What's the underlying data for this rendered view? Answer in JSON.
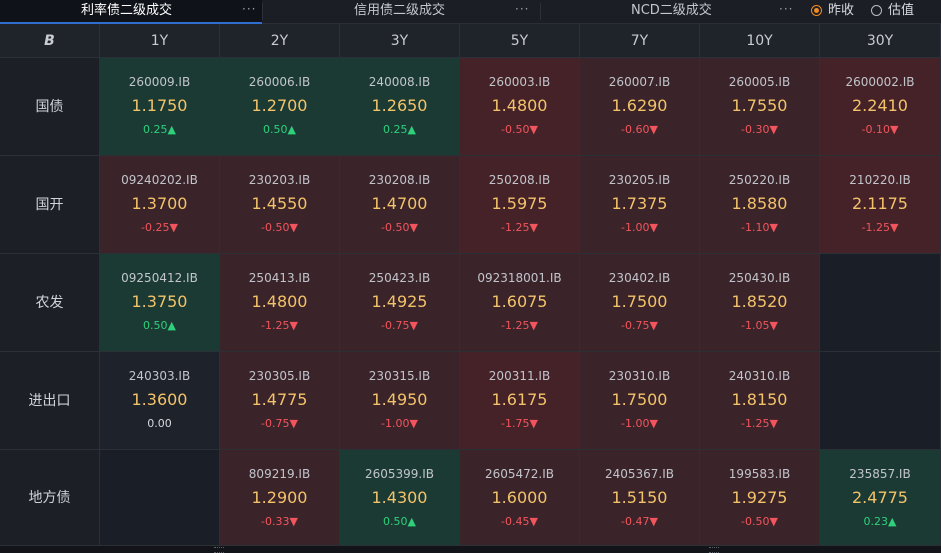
{
  "tabs": [
    {
      "label": "利率债二级成交",
      "active": true,
      "more": "···"
    },
    {
      "label": "信用债二级成交",
      "active": false,
      "more": "···"
    },
    {
      "label": "NCD二级成交",
      "active": false,
      "more": "···"
    }
  ],
  "radios": [
    {
      "label": "昨收",
      "checked": true
    },
    {
      "label": "估值",
      "checked": false
    }
  ],
  "corner_symbol": "B",
  "columns": [
    "1Y",
    "2Y",
    "3Y",
    "5Y",
    "7Y",
    "10Y",
    "30Y"
  ],
  "rows": [
    {
      "label": "国债",
      "cells": [
        {
          "code": "260009.IB",
          "price": "1.1750",
          "change": "0.25",
          "dir": "up"
        },
        {
          "code": "260006.IB",
          "price": "1.2700",
          "change": "0.50",
          "dir": "up"
        },
        {
          "code": "240008.IB",
          "price": "1.2650",
          "change": "0.25",
          "dir": "up"
        },
        {
          "code": "260003.IB",
          "price": "1.4800",
          "change": "-0.50",
          "dir": "down"
        },
        {
          "code": "260007.IB",
          "price": "1.6290",
          "change": "-0.60",
          "dir": "down"
        },
        {
          "code": "260005.IB",
          "price": "1.7550",
          "change": "-0.30",
          "dir": "down"
        },
        {
          "code": "2600002.IB",
          "price": "2.2410",
          "change": "-0.10",
          "dir": "down"
        }
      ]
    },
    {
      "label": "国开",
      "cells": [
        {
          "code": "09240202.IB",
          "price": "1.3700",
          "change": "-0.25",
          "dir": "down"
        },
        {
          "code": "230203.IB",
          "price": "1.4550",
          "change": "-0.50",
          "dir": "down"
        },
        {
          "code": "230208.IB",
          "price": "1.4700",
          "change": "-0.50",
          "dir": "down"
        },
        {
          "code": "250208.IB",
          "price": "1.5975",
          "change": "-1.25",
          "dir": "down"
        },
        {
          "code": "230205.IB",
          "price": "1.7375",
          "change": "-1.00",
          "dir": "down"
        },
        {
          "code": "250220.IB",
          "price": "1.8580",
          "change": "-1.10",
          "dir": "down"
        },
        {
          "code": "210220.IB",
          "price": "2.1175",
          "change": "-1.25",
          "dir": "down"
        }
      ]
    },
    {
      "label": "农发",
      "cells": [
        {
          "code": "09250412.IB",
          "price": "1.3750",
          "change": "0.50",
          "dir": "up"
        },
        {
          "code": "250413.IB",
          "price": "1.4800",
          "change": "-1.25",
          "dir": "down"
        },
        {
          "code": "250423.IB",
          "price": "1.4925",
          "change": "-0.75",
          "dir": "down"
        },
        {
          "code": "092318001.IB",
          "price": "1.6075",
          "change": "-1.25",
          "dir": "down"
        },
        {
          "code": "230402.IB",
          "price": "1.7500",
          "change": "-0.75",
          "dir": "down"
        },
        {
          "code": "250430.IB",
          "price": "1.8520",
          "change": "-1.05",
          "dir": "down"
        },
        null
      ]
    },
    {
      "label": "进出口",
      "cells": [
        {
          "code": "240303.IB",
          "price": "1.3600",
          "change": "0.00",
          "dir": "flat"
        },
        {
          "code": "230305.IB",
          "price": "1.4775",
          "change": "-0.75",
          "dir": "down"
        },
        {
          "code": "230315.IB",
          "price": "1.4950",
          "change": "-1.00",
          "dir": "down"
        },
        {
          "code": "200311.IB",
          "price": "1.6175",
          "change": "-1.75",
          "dir": "down"
        },
        {
          "code": "230310.IB",
          "price": "1.7500",
          "change": "-1.00",
          "dir": "down"
        },
        {
          "code": "240310.IB",
          "price": "1.8150",
          "change": "-1.25",
          "dir": "down"
        },
        null
      ]
    },
    {
      "label": "地方债",
      "cells": [
        null,
        {
          "code": "809219.IB",
          "price": "1.2900",
          "change": "-0.33",
          "dir": "down"
        },
        {
          "code": "2605399.IB",
          "price": "1.4300",
          "change": "0.50",
          "dir": "up"
        },
        {
          "code": "2605472.IB",
          "price": "1.6000",
          "change": "-0.45",
          "dir": "down"
        },
        {
          "code": "2405367.IB",
          "price": "1.5150",
          "change": "-0.47",
          "dir": "down"
        },
        {
          "code": "199583.IB",
          "price": "1.9275",
          "change": "-0.50",
          "dir": "down"
        },
        {
          "code": "235857.IB",
          "price": "2.4775",
          "change": "0.23",
          "dir": "up"
        }
      ]
    }
  ],
  "arrows": {
    "up": "▲",
    "down": "▼"
  },
  "colors": {
    "price": "#f3c36a",
    "up": "#2fd07c",
    "down": "#f2555d",
    "accent": "#f08a24",
    "active_tab_underline": "#2f6fcf"
  }
}
